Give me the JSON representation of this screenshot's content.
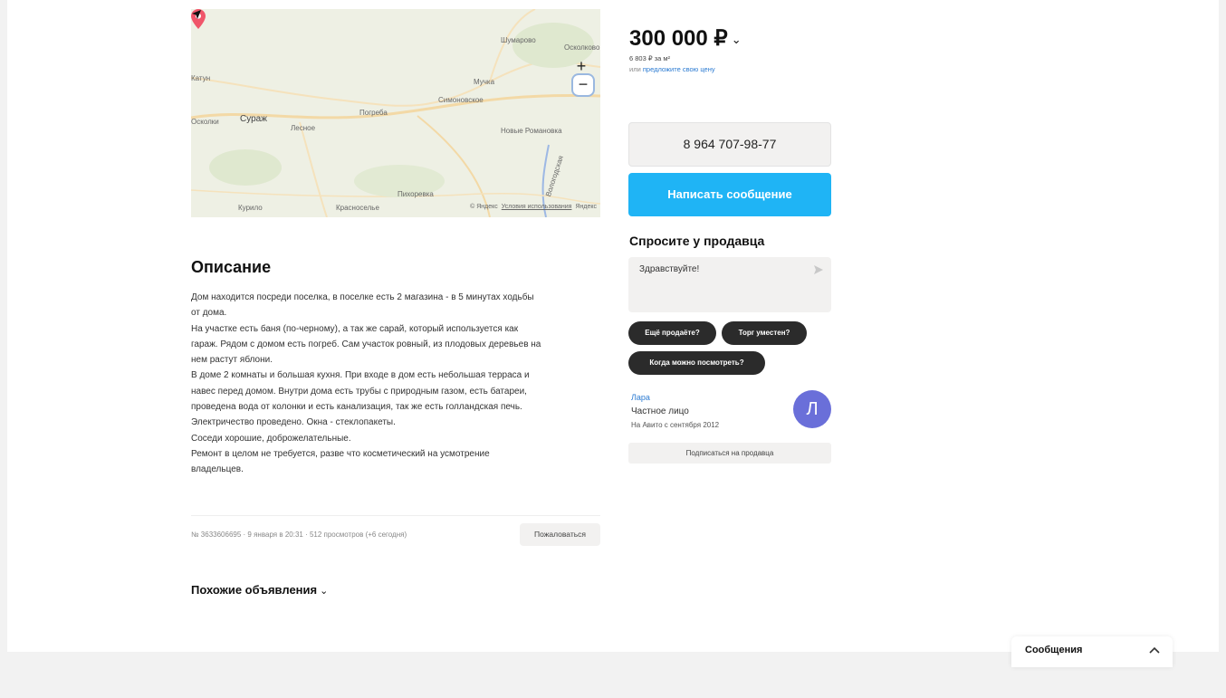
{
  "map": {
    "labels": {
      "shuvaevo": "Шумарово",
      "oskolkovo": "Осколково",
      "left_top": "Катун",
      "mokha": "Мучка",
      "simonovo": "Симоновское",
      "surazh": "Сураж",
      "oskolki": "Осколки",
      "lesnoe": "Лесное",
      "pogreb": "Погреба",
      "novaya": "Новые Романовка",
      "pikhovka": "Пихоревка",
      "kurilo": "Курило",
      "krasnoe": "Красноселье",
      "road_vertical": "Вологодская"
    },
    "zoom_in": "+",
    "zoom_out": "−",
    "copyright": "© Яндекс",
    "terms": "Условия использования",
    "brand": "Яндекс"
  },
  "description": {
    "title": "Описание",
    "lines": [
      "Дом находится посреди поселка, в поселке есть 2 магазина - в 5 минутах ходьбы",
      "от дома.",
      "На участке есть баня (по-черному), а так же сарай, который используется как",
      "гараж. Рядом с домом есть погреб. Сам участок ровный, из плодовых деревьев на",
      "нем растут яблони.",
      "В доме 2 комнаты и большая кухня. При входе в дом есть небольшая терраса и",
      "навес перед домом. Внутри дома есть трубы с природным газом, есть батареи,",
      "проведена вода от колонки и есть канализация, так же есть голландская печь.",
      "Электричество проведено. Окна - стеклопакеты.",
      "Соседи хорошие, доброжелательные.",
      "Ремонт в целом не требуется, разве что косметический на усмотрение",
      "владельцев."
    ]
  },
  "meta": {
    "text": "№ 3633606695 · 9 января в 20:31 · 512 просмотров (+6 сегодня)",
    "report": "Пожаловаться"
  },
  "similar": {
    "label": "Похожие объявления"
  },
  "price": {
    "value": "300 000 ₽",
    "per_m2": "6 803 ₽ за м²",
    "offer_prefix": "или ",
    "offer_link": "предложите свою цену"
  },
  "contact": {
    "phone": "8 964 707-98-77",
    "message_button": "Написать сообщение"
  },
  "ask": {
    "title": "Спросите у продавца",
    "input_value": "Здравствуйте!",
    "chips": [
      "Ещё продаёте?",
      "Торг уместен?",
      "Когда можно посмотреть?"
    ]
  },
  "seller": {
    "name": "Лара",
    "type": "Частное лицо",
    "since": "На Авито с сентября 2012",
    "avatar_letter": "Л",
    "avatar_color": "#6a6fd9",
    "subscribe": "Подписаться на продавца"
  },
  "messages_widget": {
    "label": "Сообщения"
  },
  "colors": {
    "accent_blue": "#1fb4f5",
    "link": "#2a7ad2",
    "chip_bg": "#2b2b2b",
    "pin": "#f0566a"
  }
}
